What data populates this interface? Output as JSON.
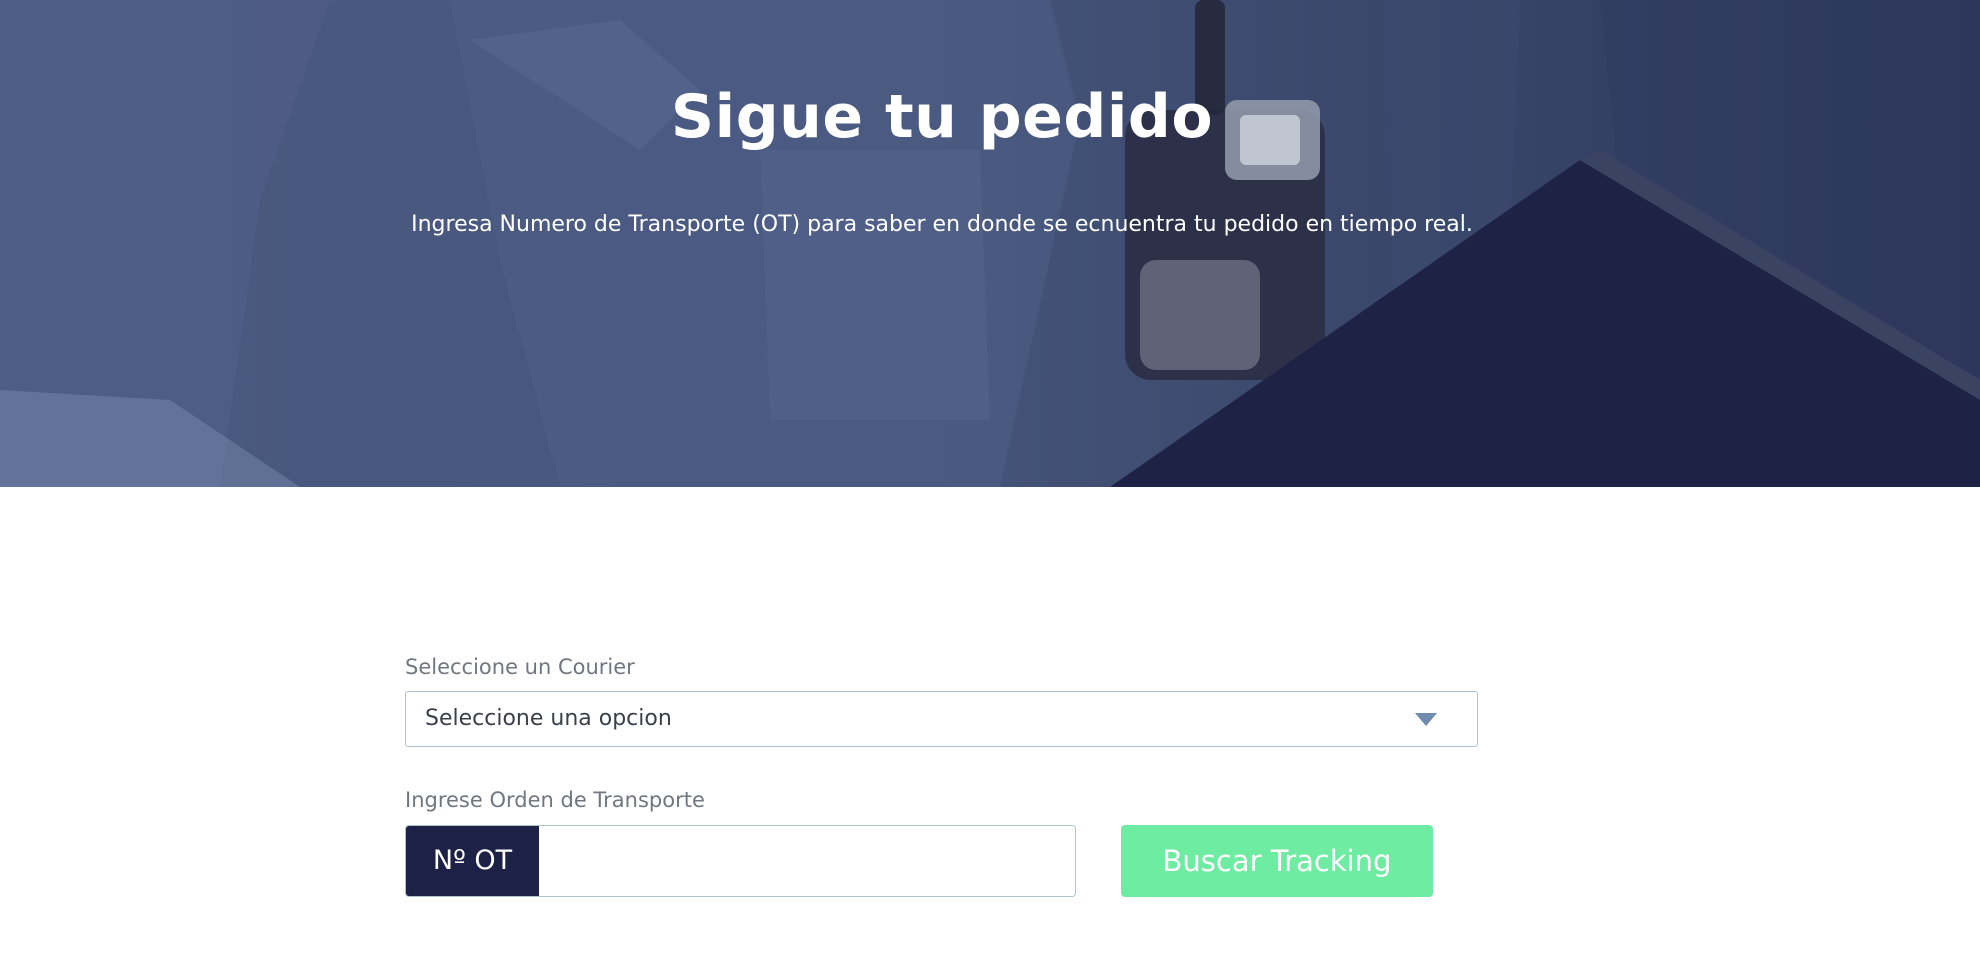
{
  "hero": {
    "title": "Sigue tu pedido",
    "subtitle": "Ingresa Numero de Transporte (OT) para saber en donde se ecnuentra tu pedido en tiempo real."
  },
  "form": {
    "courier_label": "Seleccione un Courier",
    "courier_select_value": "Seleccione una opcion",
    "ot_label": "Ingrese Orden de Transporte",
    "ot_prefix": "Nº OT",
    "ot_input_value": "",
    "search_button_label": "Buscar Tracking"
  },
  "icons": {
    "dropdown_arrow": "chevron-down-icon"
  },
  "colors": {
    "hero_overlay": "#46557b",
    "ot_prefix_bg": "#1d2146",
    "button_bg": "#6eeca2",
    "input_border": "#a9c4cf",
    "arrow": "#6f8bb0"
  }
}
